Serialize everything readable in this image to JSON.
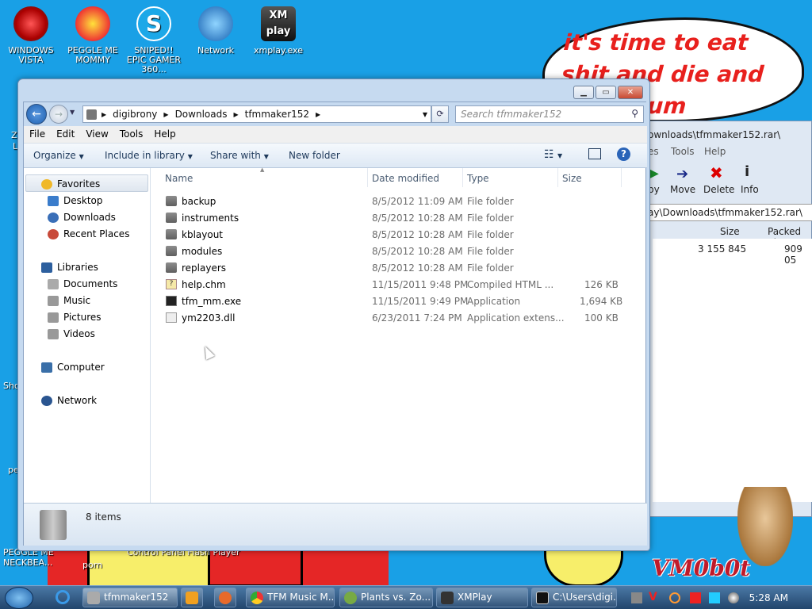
{
  "desktop": {
    "icons": [
      {
        "label": "WINDOWS VISTA"
      },
      {
        "label": "PEGGLE ME MOMMY"
      },
      {
        "label": "SNIPED!! EPIC GAMER 360..."
      },
      {
        "label": "Network"
      },
      {
        "label": "xmplay.exe"
      }
    ],
    "side_labels": [
      "Sho",
      "pe",
      "Z",
      "L"
    ],
    "bottom_labels": [
      "PEGGLE ME NECKBEA...",
      "porn",
      "Control Panel",
      "Flash Player"
    ],
    "bubble_text": "it's time to eat shit and die and chew gum",
    "watermark": "VM0b0t"
  },
  "background_window": {
    "title_path": "ownloads\\tfmmaker152.rar\\",
    "menu": [
      "es",
      "Tools",
      "Help"
    ],
    "toolbar": [
      "py",
      "Move",
      "Delete",
      "Info"
    ],
    "path": "ay\\Downloads\\tfmmaker152.rar\\",
    "columns": [
      "Size",
      "Packed Size"
    ],
    "row": {
      "size": "3 155 845",
      "packed": "909 05"
    }
  },
  "explorer": {
    "breadcrumb": [
      "digibrony",
      "Downloads",
      "tfmmaker152"
    ],
    "search_placeholder": "Search tfmmaker152",
    "menu": [
      "File",
      "Edit",
      "View",
      "Tools",
      "Help"
    ],
    "commands": [
      "Organize",
      "Include in library",
      "Share with",
      "New folder"
    ],
    "nav": {
      "favorites": "Favorites",
      "fav_items": [
        "Desktop",
        "Downloads",
        "Recent Places"
      ],
      "libraries": "Libraries",
      "lib_items": [
        "Documents",
        "Music",
        "Pictures",
        "Videos"
      ],
      "computer": "Computer",
      "network": "Network"
    },
    "columns": [
      "Name",
      "Date modified",
      "Type",
      "Size"
    ],
    "files": [
      {
        "name": "backup",
        "date": "8/5/2012 11:09 AM",
        "type": "File folder",
        "size": ""
      },
      {
        "name": "instruments",
        "date": "8/5/2012 10:28 AM",
        "type": "File folder",
        "size": ""
      },
      {
        "name": "kblayout",
        "date": "8/5/2012 10:28 AM",
        "type": "File folder",
        "size": ""
      },
      {
        "name": "modules",
        "date": "8/5/2012 10:28 AM",
        "type": "File folder",
        "size": ""
      },
      {
        "name": "replayers",
        "date": "8/5/2012 10:28 AM",
        "type": "File folder",
        "size": ""
      },
      {
        "name": "help.chm",
        "date": "11/15/2011 9:48 PM",
        "type": "Compiled HTML ...",
        "size": "126 KB"
      },
      {
        "name": "tfm_mm.exe",
        "date": "11/15/2011 9:49 PM",
        "type": "Application",
        "size": "1,694 KB"
      },
      {
        "name": "ym2203.dll",
        "date": "6/23/2011 7:24 PM",
        "type": "Application extens...",
        "size": "100 KB"
      }
    ],
    "status": "8 items"
  },
  "taskbar": {
    "buttons": [
      "tfmmaker152",
      "",
      "",
      "TFM Music M...",
      "Plants vs. Zo...",
      "XMPlay",
      "C:\\Users\\digi..."
    ],
    "clock": "5:28 AM"
  }
}
